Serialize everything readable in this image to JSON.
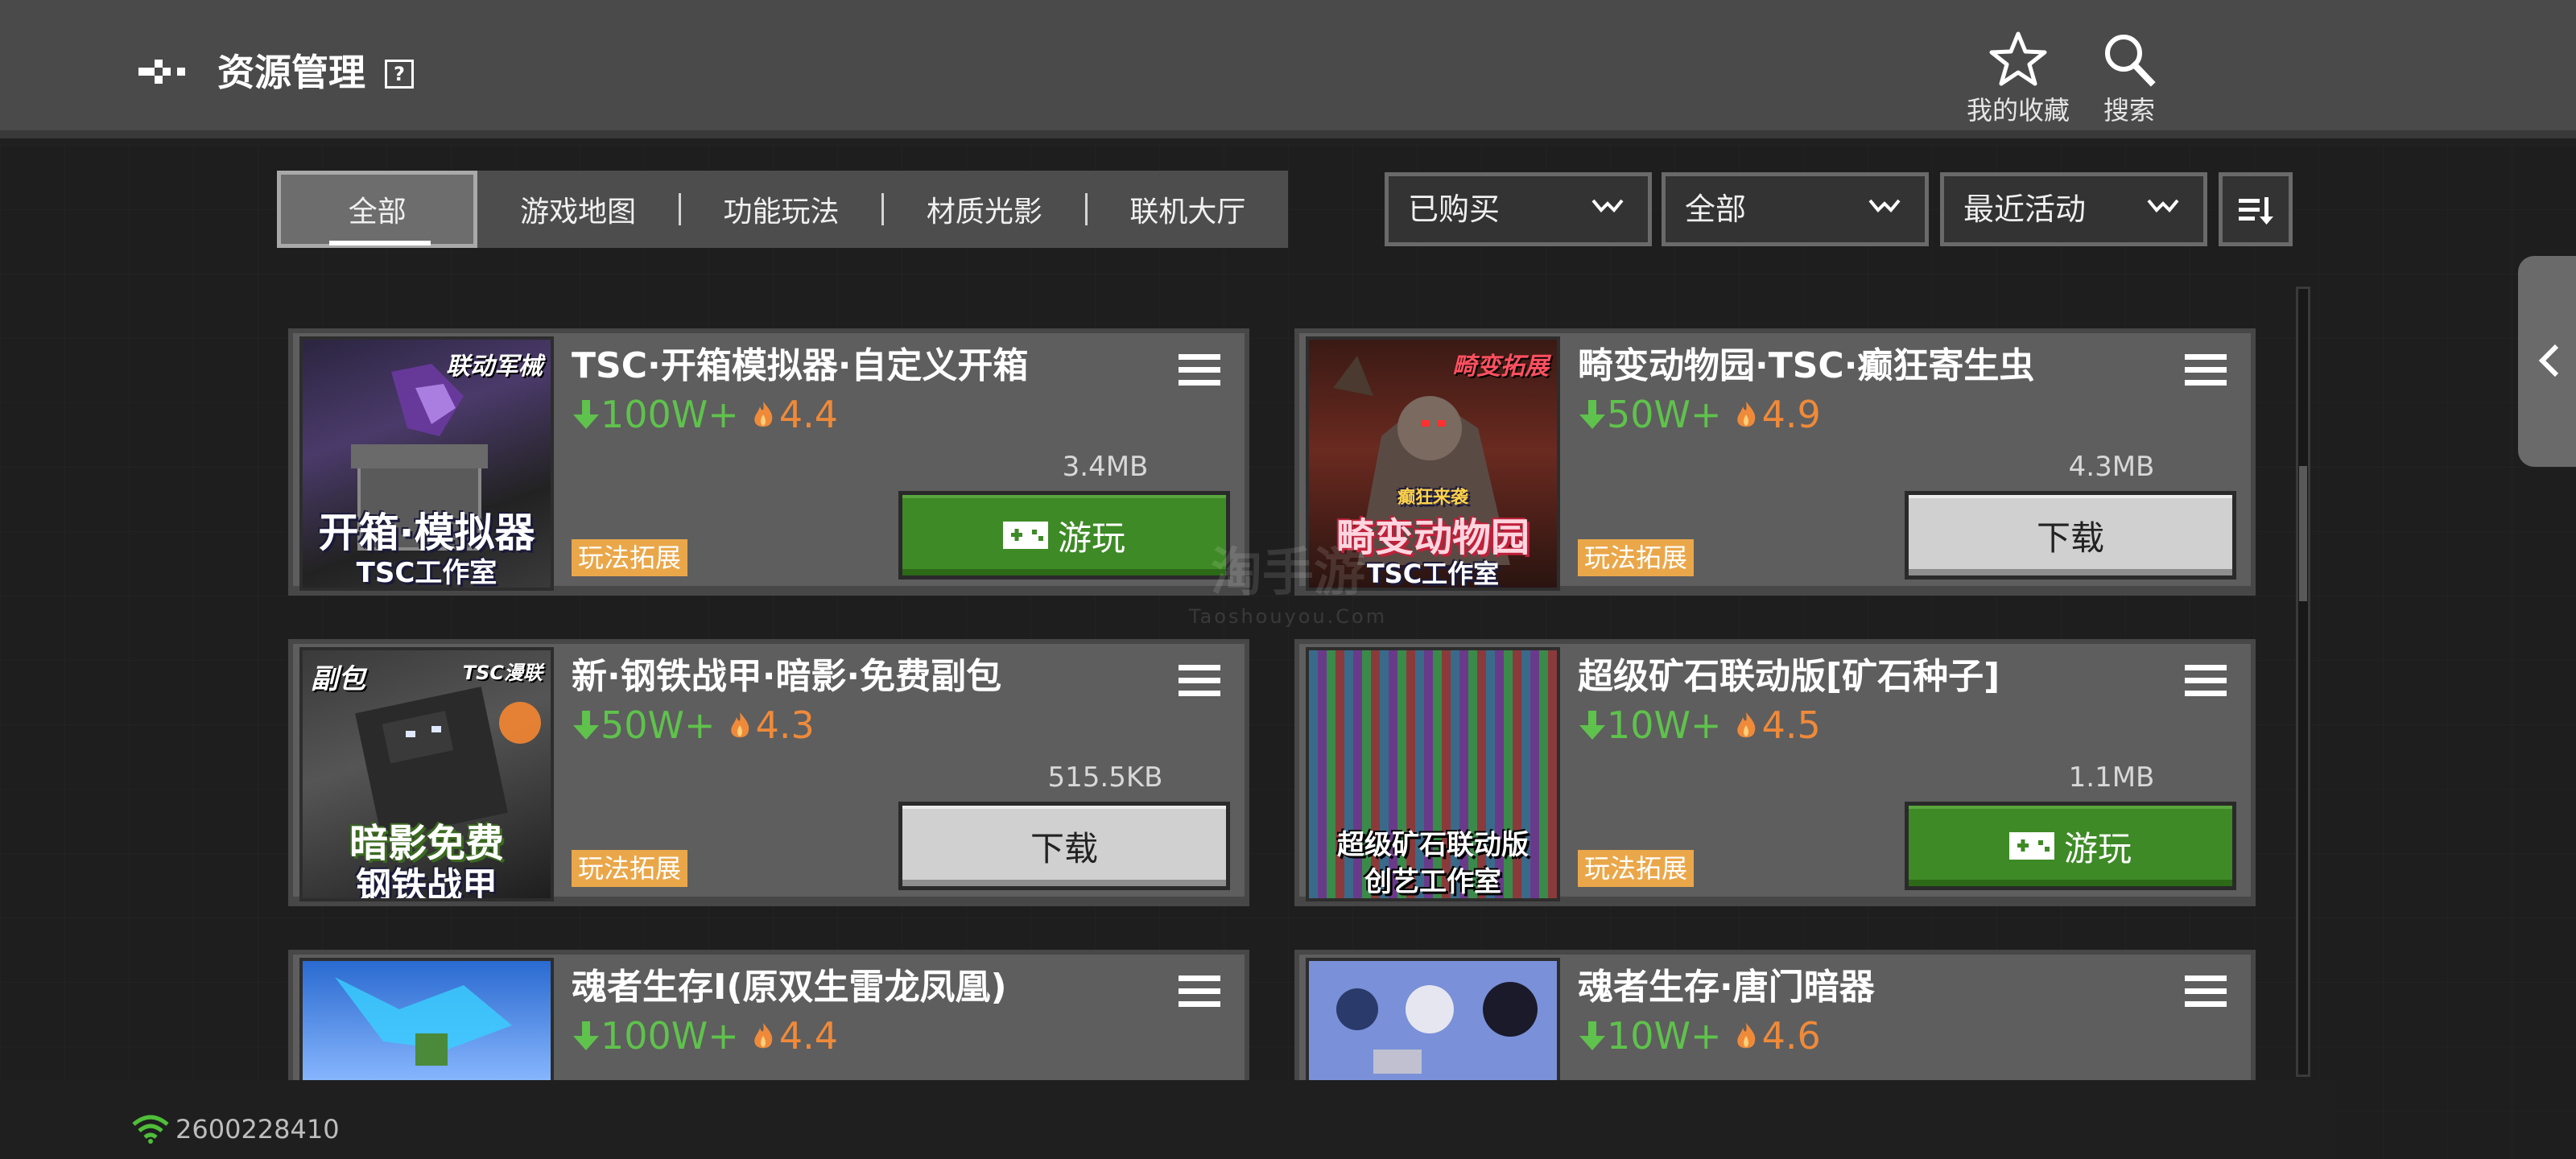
{
  "header": {
    "title": "资源管理",
    "help_label": "?",
    "favorites_label": "我的收藏",
    "search_label": "搜索"
  },
  "tabs": [
    {
      "label": "全部",
      "active": true
    },
    {
      "label": "游戏地图",
      "active": false
    },
    {
      "label": "功能玩法",
      "active": false
    },
    {
      "label": "材质光影",
      "active": false
    },
    {
      "label": "联机大厅",
      "active": false
    }
  ],
  "filters": {
    "ownership": "已购买",
    "category": "全部",
    "sort": "最近活动"
  },
  "items": [
    {
      "title": "TSC·开箱模拟器·自定义开箱",
      "downloads": "100W+",
      "rating": "4.4",
      "size": "3.4MB",
      "genre": "玩法拓展",
      "action": "游玩",
      "action_type": "play",
      "thumb_tag": "联动军械",
      "thumb_line1": "开箱·模拟器",
      "thumb_line2": "TSC工作室"
    },
    {
      "title": "畸变动物园·TSC·癫狂寄生虫",
      "downloads": "50W+",
      "rating": "4.9",
      "size": "4.3MB",
      "genre": "玩法拓展",
      "action": "下载",
      "action_type": "download",
      "thumb_tag": "畸变拓展",
      "thumb_line0": "癫狂来袭",
      "thumb_line1": "畸变动物园",
      "thumb_line2": "TSC工作室"
    },
    {
      "title": "新·钢铁战甲·暗影·免费副包",
      "downloads": "50W+",
      "rating": "4.3",
      "size": "515.5KB",
      "genre": "玩法拓展",
      "action": "下载",
      "action_type": "download",
      "thumb_tagl": "副包",
      "thumb_tag": "TSC漫联",
      "thumb_line1": "暗影免费",
      "thumb_line2": "钢铁战甲"
    },
    {
      "title": "超级矿石联动版[矿石种子]",
      "downloads": "10W+",
      "rating": "4.5",
      "size": "1.1MB",
      "genre": "玩法拓展",
      "action": "游玩",
      "action_type": "play",
      "thumb_line1": "超级矿石联动版",
      "thumb_line2": "创艺工作室"
    },
    {
      "title": "魂者生存I(原双生雷龙凤凰)",
      "downloads": "100W+",
      "rating": "4.4"
    },
    {
      "title": "魂者生存·唐门暗器",
      "downloads": "10W+",
      "rating": "4.6"
    }
  ],
  "watermark": {
    "main": "淘手游",
    "sub": "Taoshouyou.Com"
  },
  "status": {
    "id": "2600228410"
  },
  "colors": {
    "topbar": "#4a4a4a",
    "card": "#5e5e5e",
    "download_green": "#5fc24c",
    "rating_orange": "#ef8a3a",
    "play_button": "#3e8a26",
    "genre_tag": "#eaa74a"
  }
}
